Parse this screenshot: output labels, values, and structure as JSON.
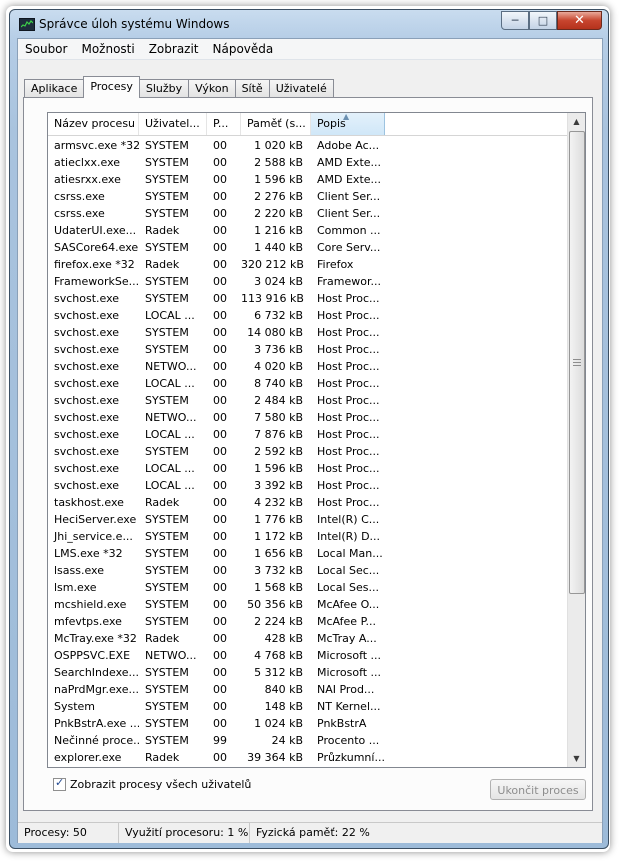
{
  "window": {
    "title": "Správce úloh systému Windows",
    "minimize": "─",
    "maximize": "□",
    "close": "✕"
  },
  "menu": [
    "Soubor",
    "Možnosti",
    "Zobrazit",
    "Nápověda"
  ],
  "tabs": [
    "Aplikace",
    "Procesy",
    "Služby",
    "Výkon",
    "Sítě",
    "Uživatelé"
  ],
  "active_tab": "Procesy",
  "columns": [
    "Název procesu",
    "Uživatel...",
    "P...",
    "Paměť (s...",
    "Popis"
  ],
  "sorted_column": "Popis",
  "processes": [
    [
      "armsvc.exe *32",
      "SYSTEM",
      "00",
      "1 020 kB",
      "Adobe Ac..."
    ],
    [
      "atieclxx.exe",
      "SYSTEM",
      "00",
      "2 588 kB",
      "AMD Exte..."
    ],
    [
      "atiesrxx.exe",
      "SYSTEM",
      "00",
      "1 596 kB",
      "AMD Exte..."
    ],
    [
      "csrss.exe",
      "SYSTEM",
      "00",
      "2 276 kB",
      "Client Ser..."
    ],
    [
      "csrss.exe",
      "SYSTEM",
      "00",
      "2 220 kB",
      "Client Ser..."
    ],
    [
      "UdaterUI.exe...",
      "Radek",
      "00",
      "1 216 kB",
      "Common ..."
    ],
    [
      "SASCore64.exe",
      "SYSTEM",
      "00",
      "1 440 kB",
      "Core Serv..."
    ],
    [
      "firefox.exe *32",
      "Radek",
      "00",
      "320 212 kB",
      "Firefox"
    ],
    [
      "FrameworkSe...",
      "SYSTEM",
      "00",
      "3 024 kB",
      "Framewor..."
    ],
    [
      "svchost.exe",
      "SYSTEM",
      "00",
      "113 916 kB",
      "Host Proc..."
    ],
    [
      "svchost.exe",
      "LOCAL ...",
      "00",
      "6 732 kB",
      "Host Proc..."
    ],
    [
      "svchost.exe",
      "SYSTEM",
      "00",
      "14 080 kB",
      "Host Proc..."
    ],
    [
      "svchost.exe",
      "SYSTEM",
      "00",
      "3 736 kB",
      "Host Proc..."
    ],
    [
      "svchost.exe",
      "NETWO...",
      "00",
      "4 020 kB",
      "Host Proc..."
    ],
    [
      "svchost.exe",
      "LOCAL ...",
      "00",
      "8 740 kB",
      "Host Proc..."
    ],
    [
      "svchost.exe",
      "SYSTEM",
      "00",
      "2 484 kB",
      "Host Proc..."
    ],
    [
      "svchost.exe",
      "NETWO...",
      "00",
      "7 580 kB",
      "Host Proc..."
    ],
    [
      "svchost.exe",
      "LOCAL ...",
      "00",
      "7 876 kB",
      "Host Proc..."
    ],
    [
      "svchost.exe",
      "SYSTEM",
      "00",
      "2 592 kB",
      "Host Proc..."
    ],
    [
      "svchost.exe",
      "LOCAL ...",
      "00",
      "1 596 kB",
      "Host Proc..."
    ],
    [
      "svchost.exe",
      "LOCAL ...",
      "00",
      "3 392 kB",
      "Host Proc..."
    ],
    [
      "taskhost.exe",
      "Radek",
      "00",
      "4 232 kB",
      "Host Proc..."
    ],
    [
      "HeciServer.exe",
      "SYSTEM",
      "00",
      "1 776 kB",
      "Intel(R) C..."
    ],
    [
      "Jhi_service.e...",
      "SYSTEM",
      "00",
      "1 172 kB",
      "Intel(R) D..."
    ],
    [
      "LMS.exe *32",
      "SYSTEM",
      "00",
      "1 656 kB",
      "Local Man..."
    ],
    [
      "lsass.exe",
      "SYSTEM",
      "00",
      "3 732 kB",
      "Local Sec..."
    ],
    [
      "lsm.exe",
      "SYSTEM",
      "00",
      "1 568 kB",
      "Local Ses..."
    ],
    [
      "mcshield.exe",
      "SYSTEM",
      "00",
      "50 356 kB",
      "McAfee O..."
    ],
    [
      "mfevtps.exe",
      "SYSTEM",
      "00",
      "2 224 kB",
      "McAfee P..."
    ],
    [
      "McTray.exe *32",
      "Radek",
      "00",
      "428 kB",
      "McTray A..."
    ],
    [
      "OSPPSVC.EXE",
      "NETWO...",
      "00",
      "4 768 kB",
      "Microsoft ..."
    ],
    [
      "SearchIndexe...",
      "SYSTEM",
      "00",
      "5 312 kB",
      "Microsoft ..."
    ],
    [
      "naPrdMgr.exe...",
      "SYSTEM",
      "00",
      "840 kB",
      "NAI Prod..."
    ],
    [
      "System",
      "SYSTEM",
      "00",
      "148 kB",
      "NT Kernel..."
    ],
    [
      "PnkBstrA.exe ...",
      "SYSTEM",
      "00",
      "1 024 kB",
      "PnkBstrA"
    ],
    [
      "Nečinné proce...",
      "SYSTEM",
      "99",
      "24 kB",
      "Procento ..."
    ],
    [
      "explorer.exe",
      "Radek",
      "00",
      "39 364 kB",
      "Průzkumní..."
    ]
  ],
  "scroll_up": "▲",
  "scroll_down": "▼",
  "show_all_users": {
    "label": "Zobrazit procesy všech uživatelů",
    "checked": true,
    "mark": "✓"
  },
  "end_process_button": "Ukončit proces",
  "status": {
    "processes": "Procesy: 50",
    "cpu": "Využití procesoru: 1 %",
    "memory": "Fyzická paměť: 22 %"
  }
}
